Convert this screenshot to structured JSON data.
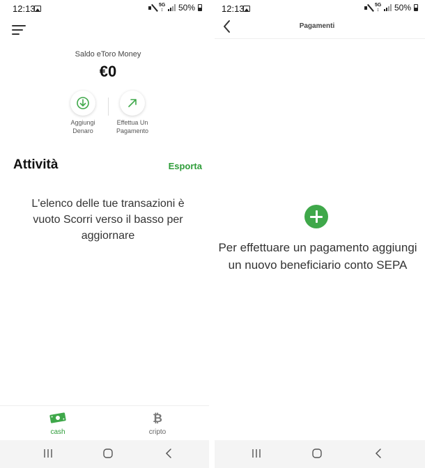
{
  "left_screen": {
    "status": {
      "time": "12:13",
      "battery": "50%"
    },
    "balance": {
      "label": "Saldo eToro Money",
      "value": "€0"
    },
    "actions": [
      {
        "line1": "Aggiungi",
        "line2": "Denaro"
      },
      {
        "line1": "Effettua Un",
        "line2": "Pagamento"
      }
    ],
    "activity": {
      "title": "Attività",
      "export_label": "Esporta",
      "empty_message": "L'elenco delle tue transazioni è vuoto Scorri verso il basso per aggiornare"
    },
    "tabs": [
      {
        "label": "cash",
        "icon": "banknote-icon",
        "active": true
      },
      {
        "label": "cripto",
        "icon": "bitcoin-icon",
        "active": false
      }
    ]
  },
  "right_screen": {
    "status": {
      "time": "12:13",
      "battery": "50%"
    },
    "title": "Pagamenti",
    "message_line1": "Per effettuare un pagamento aggiungi",
    "message_line2": "un nuovo beneficiario conto SEPA"
  },
  "colors": {
    "accent_green": "#2f9d3a",
    "add_button_green": "#3fa84a"
  }
}
